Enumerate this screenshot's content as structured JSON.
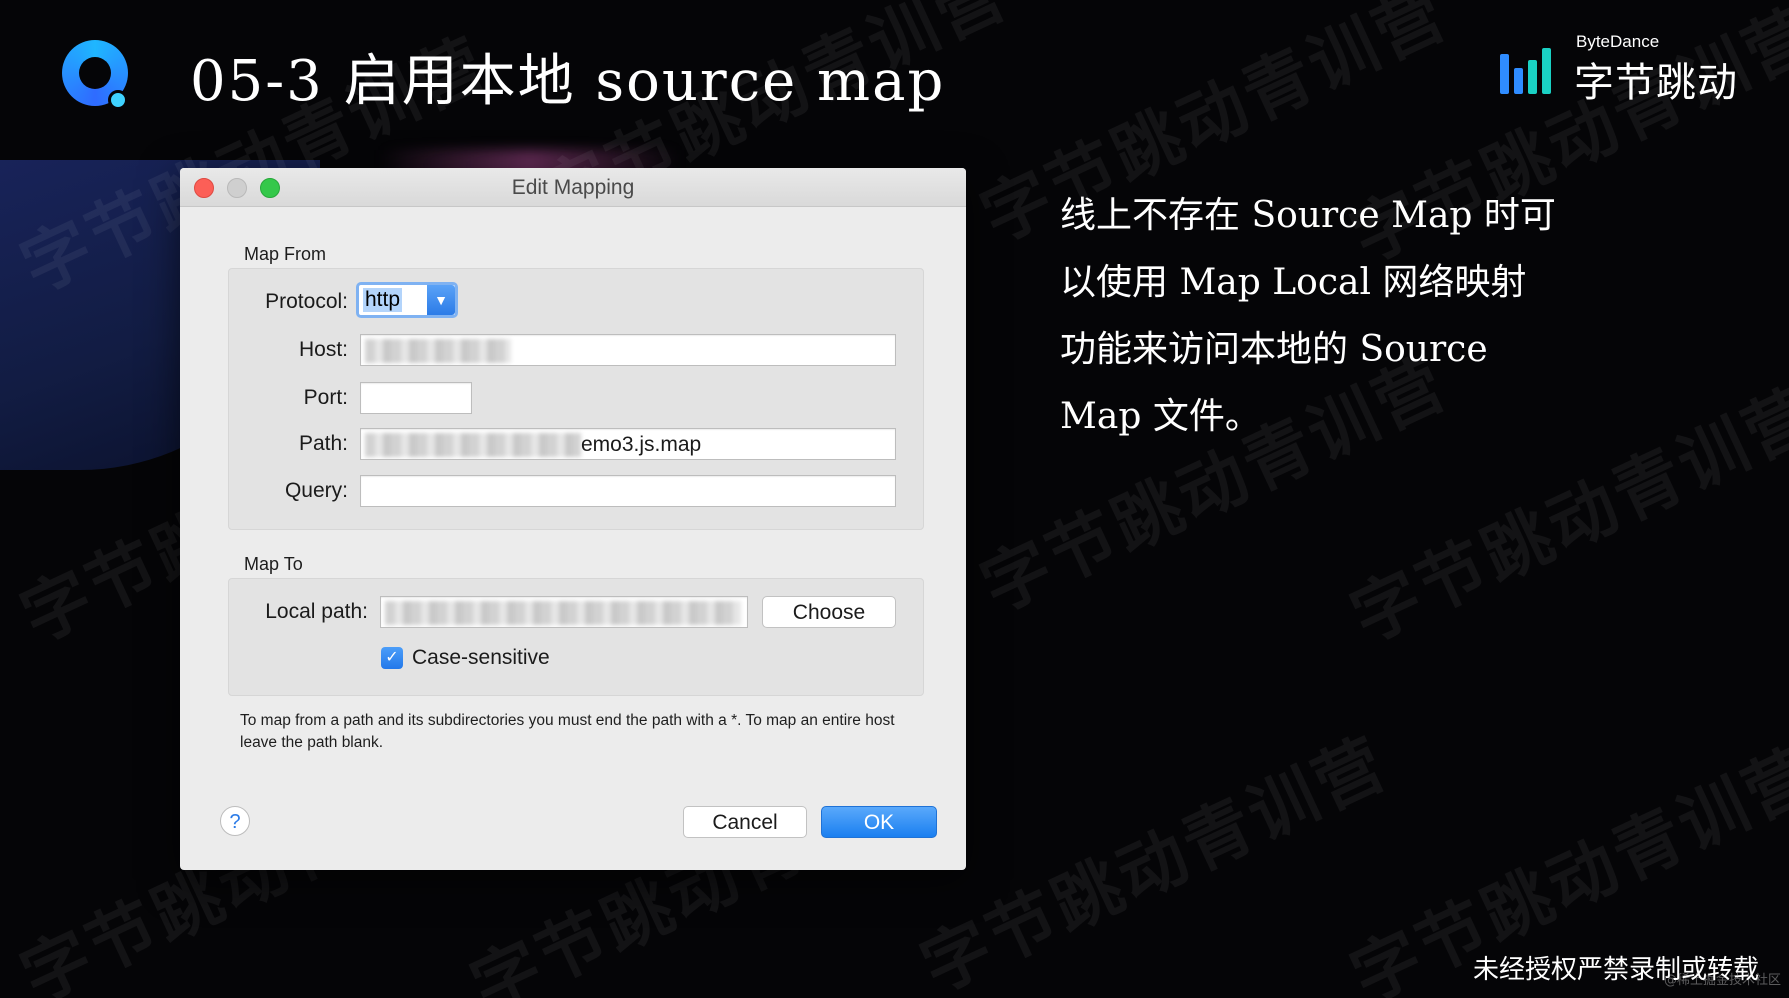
{
  "header": {
    "title": "05-3 启用本地 source map"
  },
  "brand": {
    "name_en": "ByteDance",
    "name_cn": "字节跳动"
  },
  "watermark": {
    "text": "字节跳动青训营"
  },
  "side_text": {
    "lines": [
      "线上不存在 Source Map 时可",
      "以使用 Map Local 网络映射",
      "功能来访问本地的 Source",
      "Map 文件。"
    ]
  },
  "footer": {
    "note": "未经授权严禁录制或转载",
    "credit": "@稀土掘金技术社区"
  },
  "dialog": {
    "title": "Edit Mapping",
    "map_from": {
      "label": "Map From",
      "protocol_label": "Protocol:",
      "protocol_value": "http",
      "host_label": "Host:",
      "host_value": "",
      "port_label": "Port:",
      "port_value": "",
      "path_label": "Path:",
      "path_value_visible": "emo3.js.map",
      "query_label": "Query:",
      "query_value": ""
    },
    "map_to": {
      "label": "Map To",
      "local_path_label": "Local path:",
      "local_path_value": "",
      "choose_label": "Choose",
      "case_sensitive_label": "Case-sensitive",
      "case_sensitive_checked": true
    },
    "help_text": "To map from a path and its subdirectories you must end the path with a *. To map an entire host leave the path blank.",
    "help_icon": "?",
    "cancel_label": "Cancel",
    "ok_label": "OK"
  },
  "colors": {
    "accent_blue": "#2b7be7",
    "traffic_red": "#fc5f57",
    "traffic_yellow": "#c9c9c9",
    "traffic_green": "#34c84a",
    "brand_bar_1": "#2f8cff",
    "brand_bar_2": "#1ad1c4"
  }
}
